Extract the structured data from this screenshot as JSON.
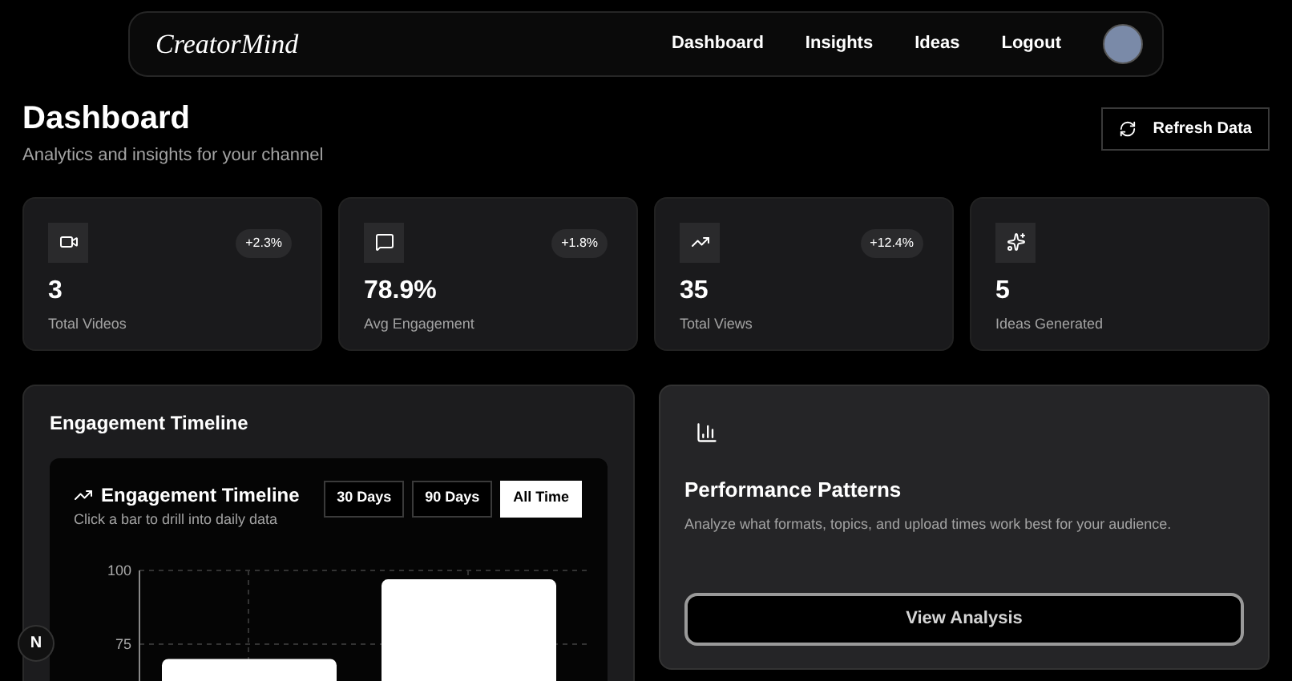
{
  "navbar": {
    "logo": "CreatorMind",
    "links": [
      {
        "label": "Dashboard"
      },
      {
        "label": "Insights"
      },
      {
        "label": "Ideas"
      },
      {
        "label": "Logout"
      }
    ]
  },
  "header": {
    "title": "Dashboard",
    "subtitle": "Analytics and insights for your channel",
    "refresh_button": "Refresh Data"
  },
  "stats": [
    {
      "kind": "videos",
      "value": "3",
      "label": "Total Videos",
      "change": "+2.3%"
    },
    {
      "kind": "engagement",
      "value": "78.9%",
      "label": "Avg Engagement",
      "change": "+1.8%"
    },
    {
      "kind": "views",
      "value": "35",
      "label": "Total Views",
      "change": "+12.4%"
    },
    {
      "kind": "ideas",
      "value": "5",
      "label": "Ideas Generated"
    }
  ],
  "timeline_panel": {
    "title": "Engagement Timeline",
    "chart_card": {
      "title": "Engagement Timeline",
      "subtitle": "Click a bar to drill into daily data",
      "ranges": [
        {
          "label": "30 Days",
          "selected": false
        },
        {
          "label": "90 Days",
          "selected": false
        },
        {
          "label": "All Time",
          "selected": true
        }
      ],
      "chart_data": {
        "type": "bar",
        "values": [
          70,
          97
        ],
        "ylim": [
          0,
          100
        ],
        "yticks": [
          75,
          100
        ]
      }
    }
  },
  "patterns_panel": {
    "title": "Performance Patterns",
    "description": "Analyze what formats, topics, and upload times work best for your audience.",
    "button": "View Analysis"
  },
  "dev_badge": "N"
}
